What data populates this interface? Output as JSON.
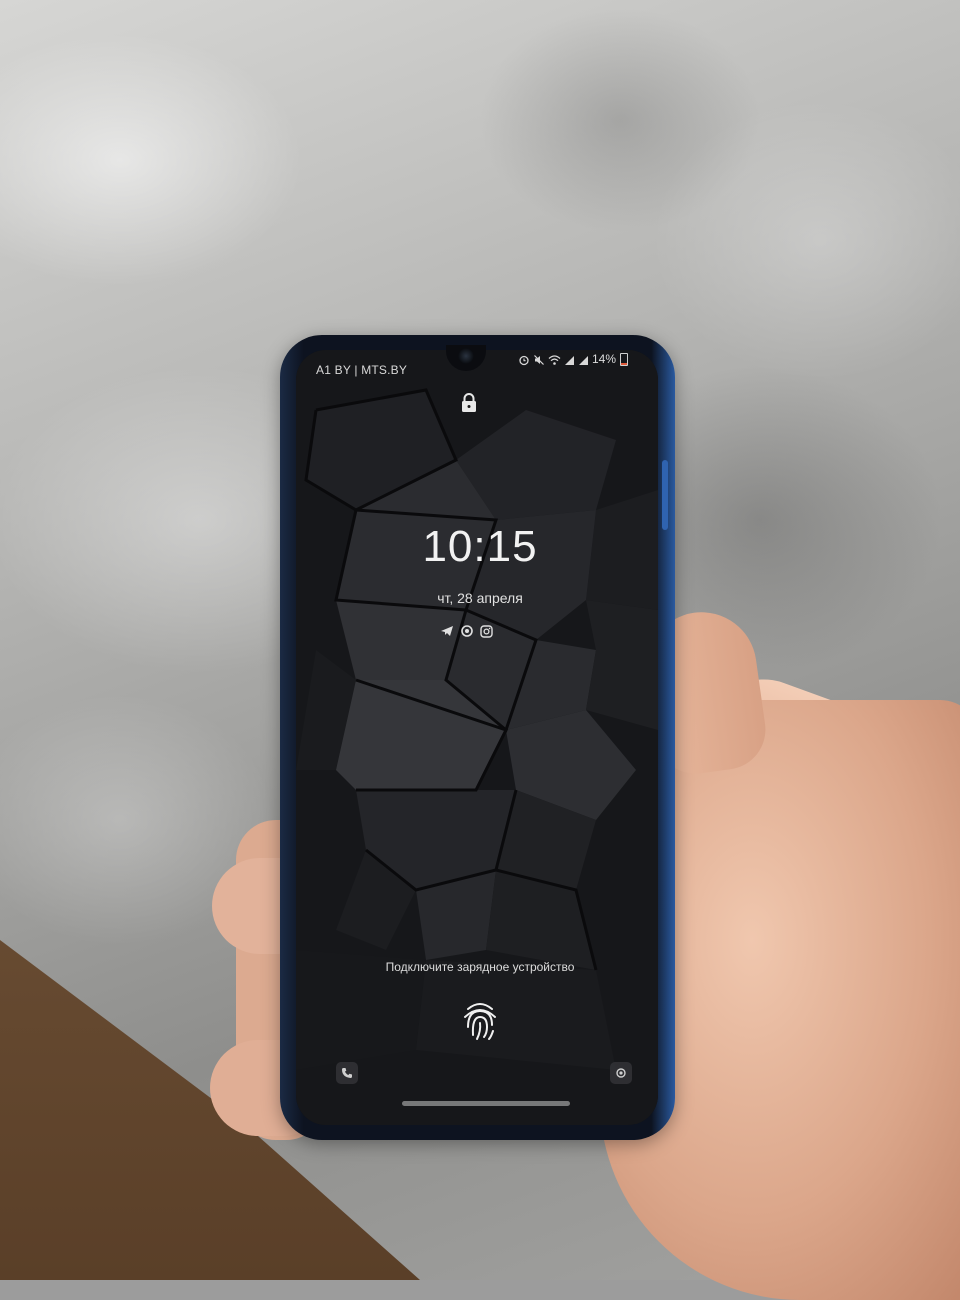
{
  "status_bar": {
    "carrier": "A1 BY | MTS.BY",
    "battery": "14%",
    "icons": [
      "alarm-icon",
      "mute-icon",
      "wifi-icon",
      "signal-icon",
      "signal-icon",
      "battery-icon"
    ]
  },
  "lock_screen": {
    "time": "10:15",
    "date": "чт, 28 апреля",
    "notification_icons": [
      "telegram-icon",
      "sync-icon",
      "instagram-icon"
    ],
    "charge_message": "Подключите зарядное устройство"
  },
  "shortcuts": {
    "left": "phone-icon",
    "right": "camera-icon"
  }
}
